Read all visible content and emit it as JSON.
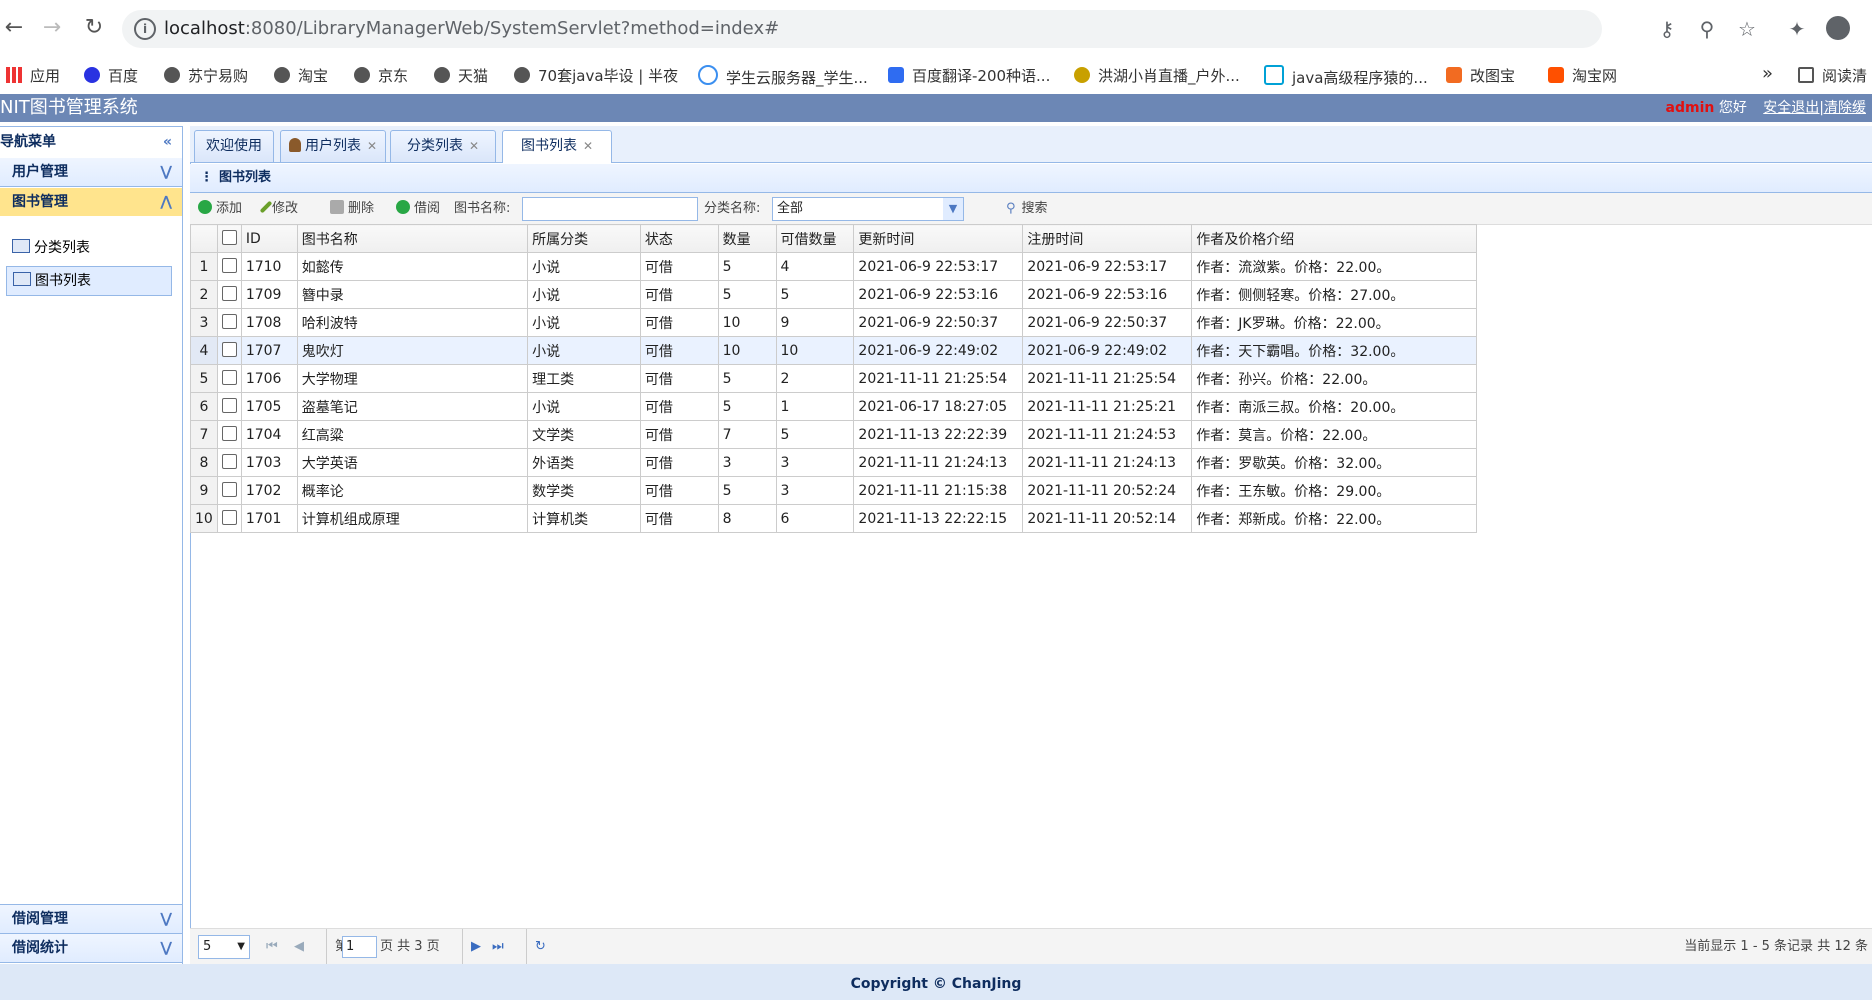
{
  "browser": {
    "url_host": "localhost",
    "url_path": ":8080/LibraryManagerWeb/SystemServlet?method=index#",
    "bookmarks": [
      "应用",
      "百度",
      "苏宁易购",
      "淘宝",
      "京东",
      "天猫",
      "70套java毕设 | 半夜",
      "学生云服务器_学生...",
      "百度翻译-200种语...",
      "洪湖小肖直播_户外...",
      "java高级程序猿的...",
      "改图宝",
      "淘宝网"
    ],
    "more": "»",
    "reading_list": "阅读清"
  },
  "header": {
    "title": "NIT图书管理系统",
    "user": "admin",
    "greeting": "您好",
    "logout": "安全退出|清除缓"
  },
  "sidebar": {
    "title": "导航菜单",
    "panels": [
      "用户管理",
      "图书管理",
      "借阅管理",
      "借阅统计"
    ],
    "items": [
      "分类列表",
      "图书列表"
    ]
  },
  "tabs": [
    {
      "label": "欢迎使用"
    },
    {
      "label": "用户列表"
    },
    {
      "label": "分类列表"
    },
    {
      "label": "图书列表"
    }
  ],
  "panel_title": "图书列表",
  "toolbar": {
    "add": "添加",
    "edit": "修改",
    "delete": "删除",
    "borrow": "借阅",
    "name_label": "图书名称:",
    "name_value": "",
    "category_label": "分类名称:",
    "category_value": "全部",
    "search": "搜索"
  },
  "grid": {
    "columns": [
      "ID",
      "图书名称",
      "所属分类",
      "状态",
      "数量",
      "可借数量",
      "更新时间",
      "注册时间",
      "作者及价格介绍"
    ],
    "rows": [
      {
        "n": "1",
        "id": "1710",
        "name": "如懿传",
        "cat": "小说",
        "status": "可借",
        "qty": "5",
        "avail": "4",
        "updated": "2021-06-9 22:53:17",
        "created": "2021-06-9 22:53:17",
        "info": "作者：流潋紫。价格：22.00。"
      },
      {
        "n": "2",
        "id": "1709",
        "name": "簪中录",
        "cat": "小说",
        "status": "可借",
        "qty": "5",
        "avail": "5",
        "updated": "2021-06-9 22:53:16",
        "created": "2021-06-9 22:53:16",
        "info": "作者：侧侧轻寒。价格：27.00。"
      },
      {
        "n": "3",
        "id": "1708",
        "name": "哈利波特",
        "cat": "小说",
        "status": "可借",
        "qty": "10",
        "avail": "9",
        "updated": "2021-06-9 22:50:37",
        "created": "2021-06-9 22:50:37",
        "info": "作者：JK罗琳。价格：22.00。"
      },
      {
        "n": "4",
        "id": "1707",
        "name": "鬼吹灯",
        "cat": "小说",
        "status": "可借",
        "qty": "10",
        "avail": "10",
        "updated": "2021-06-9 22:49:02",
        "created": "2021-06-9 22:49:02",
        "info": "作者：天下霸唱。价格：32.00。"
      },
      {
        "n": "5",
        "id": "1706",
        "name": "大学物理",
        "cat": "理工类",
        "status": "可借",
        "qty": "5",
        "avail": "2",
        "updated": "2021-11-11 21:25:54",
        "created": "2021-11-11 21:25:54",
        "info": "作者：孙兴。价格：22.00。"
      },
      {
        "n": "6",
        "id": "1705",
        "name": "盗墓笔记",
        "cat": "小说",
        "status": "可借",
        "qty": "5",
        "avail": "1",
        "updated": "2021-06-17 18:27:05",
        "created": "2021-11-11 21:25:21",
        "info": "作者：南派三叔。价格：20.00。"
      },
      {
        "n": "7",
        "id": "1704",
        "name": "红高粱",
        "cat": "文学类",
        "status": "可借",
        "qty": "7",
        "avail": "5",
        "updated": "2021-11-13 22:22:39",
        "created": "2021-11-11 21:24:53",
        "info": "作者：莫言。价格：22.00。"
      },
      {
        "n": "8",
        "id": "1703",
        "name": "大学英语",
        "cat": "外语类",
        "status": "可借",
        "qty": "3",
        "avail": "3",
        "updated": "2021-11-11 21:24:13",
        "created": "2021-11-11 21:24:13",
        "info": "作者：罗歇英。价格：32.00。"
      },
      {
        "n": "9",
        "id": "1702",
        "name": "概率论",
        "cat": "数学类",
        "status": "可借",
        "qty": "5",
        "avail": "3",
        "updated": "2021-11-11 21:15:38",
        "created": "2021-11-11 20:52:24",
        "info": "作者：王东敏。价格：29.00。"
      },
      {
        "n": "10",
        "id": "1701",
        "name": "计算机组成原理",
        "cat": "计算机类",
        "status": "可借",
        "qty": "8",
        "avail": "6",
        "updated": "2021-11-13 22:22:15",
        "created": "2021-11-11 20:52:14",
        "info": "作者：郑新成。价格：22.00。"
      }
    ]
  },
  "pager": {
    "page_size": "5",
    "page_prefix": "第",
    "page_value": "1",
    "page_suffix": "页 共 3 页",
    "summary": "当前显示 1 - 5 条记录 共 12 条"
  },
  "footer": "Copyright © ChanJing"
}
